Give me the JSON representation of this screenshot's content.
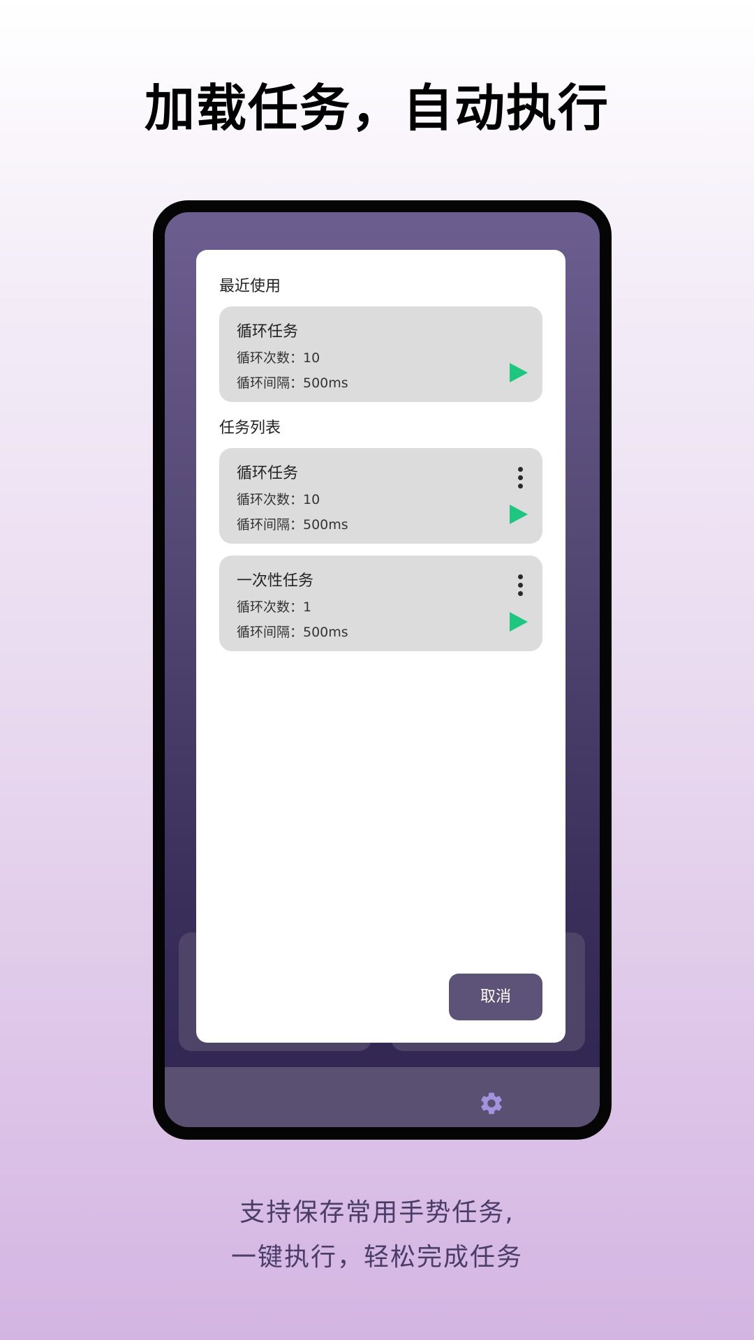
{
  "headline": "加载任务，自动执行",
  "dialog": {
    "recent_label": "最近使用",
    "list_label": "任务列表",
    "recent_tasks": [
      {
        "title": "循环任务",
        "count": "循环次数：10",
        "interval": "循环间隔：500ms"
      }
    ],
    "tasks": [
      {
        "title": "循环任务",
        "count": "循环次数：10",
        "interval": "循环间隔：500ms"
      },
      {
        "title": "一次性任务",
        "count": "循环次数：1",
        "interval": "循环间隔：500ms"
      }
    ],
    "cancel_label": "取消"
  },
  "bottom_nav": {
    "items": [
      {
        "icon": "dashboard-icon"
      },
      {
        "icon": "gear-icon"
      }
    ]
  },
  "caption": {
    "line1": "支持保存常用手势任务,",
    "line2": "一键执行，轻松完成任务"
  },
  "colors": {
    "play": "#1ec77f",
    "gear": "#a393de",
    "dialog_button": "#5d5378"
  }
}
